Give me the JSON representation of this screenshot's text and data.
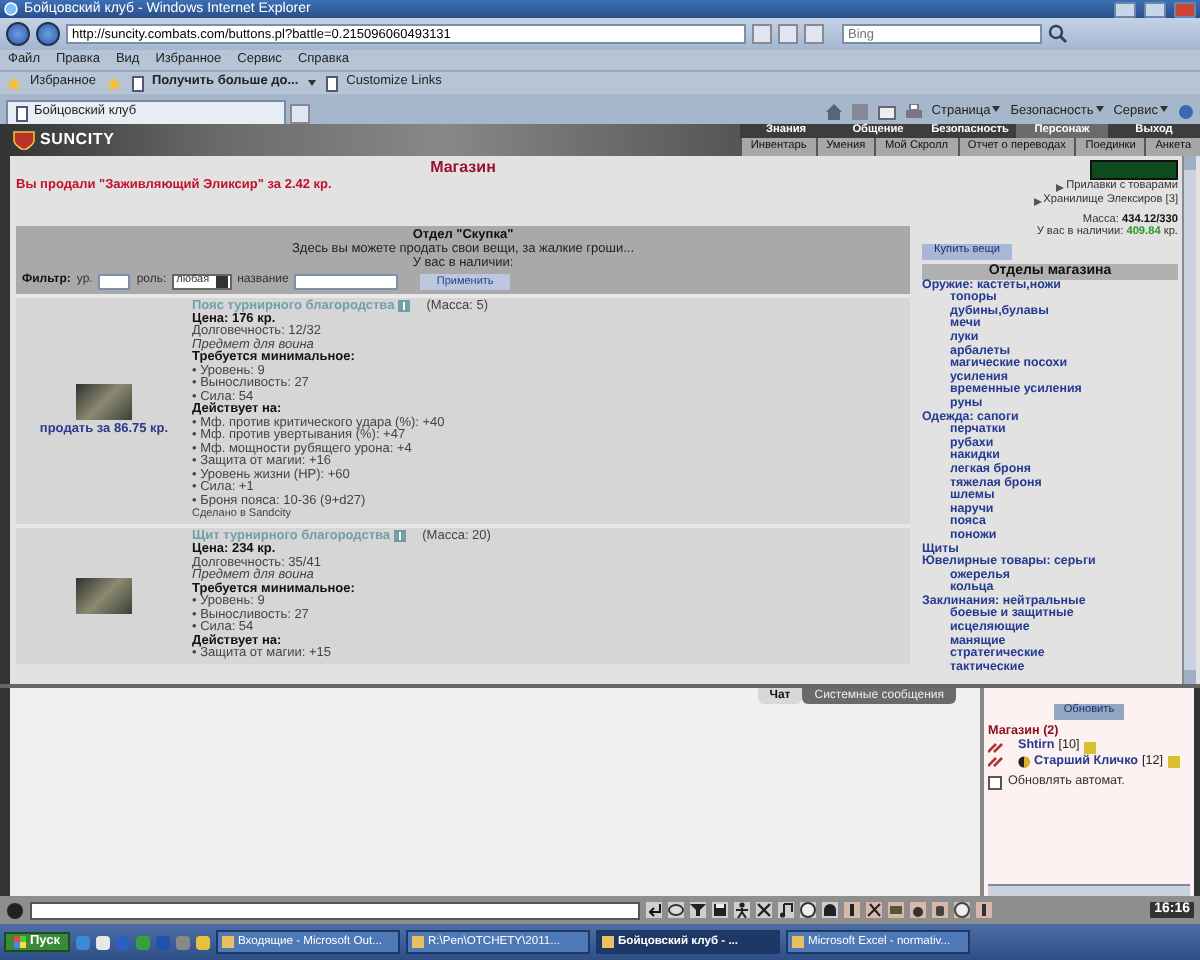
{
  "window": {
    "title": "Бойцовский клуб - Windows Internet Explorer"
  },
  "address_bar": {
    "url": "http://suncity.combats.com/buttons.pl?battle=0.215096060493131"
  },
  "search": {
    "placeholder": "Bing"
  },
  "menu": [
    "Файл",
    "Правка",
    "Вид",
    "Избранное",
    "Сервис",
    "Справка"
  ],
  "favorites_bar": {
    "favorites": "Избранное",
    "links": [
      "Получить больше до...",
      "Customize Links"
    ]
  },
  "tabs": [
    {
      "label": "Бойцовский клуб",
      "selected": true
    }
  ],
  "command_bar": [
    "Страница",
    "Безопасность",
    "Сервис"
  ],
  "game_header": {
    "logo": "SUNCITY",
    "main_nav": [
      {
        "label": "Знания",
        "selected": false
      },
      {
        "label": "Общение",
        "selected": false
      },
      {
        "label": "Безопасность",
        "selected": false
      },
      {
        "label": "Персонаж",
        "selected": true
      },
      {
        "label": "Выход",
        "selected": false
      }
    ],
    "sub_nav": [
      "Инвентарь",
      "Умения",
      "Мой Скролл",
      "Отчет о переводах",
      "Поединки",
      "Анкета"
    ]
  },
  "shop": {
    "title": "Магазин",
    "message": "Вы продали \"Заживляющий Эликсир\" за 2.42 кр.",
    "links": [
      "Прилавки с товарами",
      "Хранилище Элексиров [3]"
    ],
    "mass_label": "Масса:",
    "mass": "434.12/330",
    "money_label": "У вас в наличии:",
    "money": "409.84",
    "money_unit": "кр."
  },
  "department": {
    "title": "Отдел \"Скупка\"",
    "description": "Здесь вы можете продать свои вещи, за жалкие гроши...",
    "money_label": "У вас в наличии:"
  },
  "filter": {
    "label": "Фильтр:",
    "level_label": "ур.",
    "role_label": "роль:",
    "role_value": "любая",
    "name_label": "название",
    "apply": "Применить"
  },
  "items": [
    {
      "name": "Пояс турнирного благородства",
      "mass": "(Масса: 5)",
      "price": "Цена: 176 кр.",
      "durability": "Долговечность: 12/32",
      "note": "Предмет для воина",
      "requirements_title": "Требуется минимальное:",
      "requirements": [
        "• Уровень: 9",
        "• Выносливость: 27",
        "• Сила: 54"
      ],
      "effects_title": "Действует на:",
      "effects": [
        "• Мф. против критического удара (%): +40",
        "• Мф. против увертывания (%): +47",
        "• Мф. мощности рубящего урона: +4",
        "• Защита от магии: +16",
        "• Уровень жизни (HP): +60",
        "• Сила: +1",
        "• Броня пояса: 10-36 (9+d27)"
      ],
      "footer": "Сделано в Sandcity",
      "sell": "продать за 86.75 кр."
    },
    {
      "name": "Щит турнирного благородства",
      "mass": "(Масса: 20)",
      "price": "Цена: 234 кр.",
      "durability": "Долговечность: 35/41",
      "note": "Предмет для воина",
      "requirements_title": "Требуется минимальное:",
      "requirements": [
        "• Уровень: 9",
        "• Выносливость: 27",
        "• Сила: 54"
      ],
      "effects_title": "Действует на:",
      "effects": [
        "• Защита от магии: +15"
      ]
    }
  ],
  "sidebar": {
    "buy_button": "Купить вещи",
    "header": "Отделы магазина",
    "categories": [
      {
        "label": "Оружие: кастеты,ножи",
        "children": [
          {
            "label": "топоры"
          },
          {
            "label": "дубины,булавы"
          },
          {
            "label": "мечи"
          },
          {
            "label": "луки"
          },
          {
            "label": "арбалеты"
          },
          {
            "label": "магические посохи"
          },
          {
            "label": "усиления"
          },
          {
            "label": "временные усиления"
          },
          {
            "label": "руны"
          }
        ]
      },
      {
        "label": "Одежда: сапоги",
        "children": [
          {
            "label": "перчатки"
          },
          {
            "label": "рубахи"
          },
          {
            "label": "накидки"
          },
          {
            "label": "легкая броня"
          },
          {
            "label": "тяжелая броня"
          },
          {
            "label": "шлемы"
          },
          {
            "label": "наручи"
          },
          {
            "label": "пояса"
          },
          {
            "label": "поножи"
          }
        ]
      },
      {
        "label": "Щиты"
      },
      {
        "label": "Ювелирные товары: серьги",
        "children": [
          {
            "label": "ожерелья"
          },
          {
            "label": "кольца"
          }
        ]
      },
      {
        "label": "Заклинания: нейтральные",
        "children": [
          {
            "label": "боевые и защитные"
          },
          {
            "label": "исцеляющие"
          },
          {
            "label": "манящие"
          },
          {
            "label": "стратегические"
          },
          {
            "label": "тактические"
          }
        ]
      }
    ]
  },
  "chat": {
    "tabs": [
      {
        "label": "Чат",
        "selected": true
      },
      {
        "label": "Системные сообщения",
        "selected": false
      }
    ],
    "refresh": "Обновить",
    "room": "Магазин (2)",
    "users": [
      {
        "name": "Shtirn",
        "level": "[10]",
        "align_icon": false
      },
      {
        "name": "Старший Кличко",
        "level": "[12]",
        "align_icon": true
      }
    ],
    "auto_refresh": {
      "label": "Обновлять автомат.",
      "checked": false
    }
  },
  "clock": "16:16",
  "taskbar": {
    "start": "Пуск",
    "tasks": [
      {
        "label": "Входящие - Microsoft Out...",
        "selected": false
      },
      {
        "label": "R:\\Pen\\OTCHETY\\2011...",
        "selected": false
      },
      {
        "label": "Бойцовский клуб - ...",
        "selected": true
      },
      {
        "label": "Microsoft Excel - normativ...",
        "selected": false
      }
    ]
  }
}
